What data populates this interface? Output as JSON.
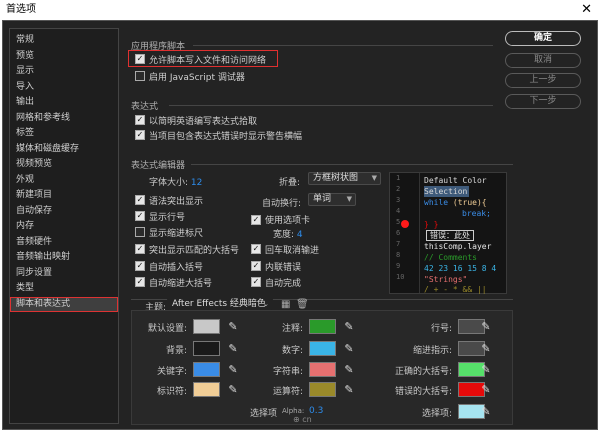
{
  "window": {
    "title": "首选项"
  },
  "sidebar": {
    "items": [
      "常规",
      "预览",
      "显示",
      "导入",
      "输出",
      "网格和参考线",
      "标签",
      "媒体和磁盘缓存",
      "视频预览",
      "外观",
      "新建项目",
      "自动保存",
      "内存",
      "音频硬件",
      "音频输出映射",
      "同步设置",
      "类型",
      "脚本和表达式"
    ],
    "active_index": 17
  },
  "buttons": {
    "ok": "确定",
    "cancel": "取消",
    "prev": "上一步",
    "next": "下一步"
  },
  "app_scripts": {
    "title": "应用程序脚本",
    "allow_write": {
      "label": "允许脚本写入文件和访问网络",
      "checked": true
    },
    "js_debugger": {
      "label": "启用 JavaScript 调试器",
      "checked": false
    }
  },
  "expressions": {
    "title": "表达式",
    "pick_english": {
      "label": "以简明英语编写表达式拾取",
      "checked": true
    },
    "warn_banner": {
      "label": "当项目包含表达式错误时显示警告横幅",
      "checked": true
    }
  },
  "editor": {
    "title": "表达式编辑器",
    "font_size_label": "字体大小:",
    "font_size": "12",
    "fold_label": "折叠:",
    "fold_value": "方框树状图",
    "autowrap_label": "自动换行:",
    "autowrap_value": "单词",
    "syntax_highlight": {
      "label": "语法突出显示",
      "checked": true
    },
    "line_numbers": {
      "label": "显示行号",
      "checked": true
    },
    "indent_guides": {
      "label": "显示缩进标尺",
      "checked": false
    },
    "match_brackets": {
      "label": "突出显示匹配的大括号",
      "checked": true
    },
    "auto_brackets": {
      "label": "自动插入括号",
      "checked": true
    },
    "auto_indent": {
      "label": "自动缩进大括号",
      "checked": true
    },
    "tabs": {
      "label": "使用选项卡",
      "checked": true
    },
    "width_label": "宽度:",
    "width_value": "4",
    "enter_accept": {
      "label": "回车取消输进",
      "checked": true
    },
    "inline_errors": {
      "label": "内联错误",
      "checked": true
    },
    "autocomplete": {
      "label": "自动完成",
      "checked": true
    }
  },
  "code_preview": {
    "line_numbers": [
      "1",
      "2",
      "3",
      "4",
      "5",
      "6",
      "7",
      "8",
      "9",
      "10"
    ],
    "line1": "Default Color",
    "line2": "Selection",
    "line3a": "while",
    "line3b": " (true){",
    "line4": "break;",
    "line5": "} }",
    "error_label": "错误：此处",
    "line6": "thisComp.layer",
    "line7": "// Comments",
    "line8": "42 23 16 15 8 4",
    "line9": "\"Strings\"",
    "line10": "/ + - * && ||"
  },
  "theme": {
    "label": "主题:",
    "value": "After Effects 经典暗色",
    "rows": [
      [
        {
          "label": "默认设置:",
          "color": "#c8c8c8"
        },
        {
          "label": "注释:",
          "color": "#2a9a2a"
        },
        {
          "label": "行号:",
          "color": "#4a4a4a"
        }
      ],
      [
        {
          "label": "背景:",
          "color": "#1a1a1a"
        },
        {
          "label": "数字:",
          "color": "#3ab4e6"
        },
        {
          "label": "缩进指示:",
          "color": "#4a4a4a"
        }
      ],
      [
        {
          "label": "关键字:",
          "color": "#3a8ce6"
        },
        {
          "label": "字符串:",
          "color": "#e67070"
        },
        {
          "label": "正确的大括号:",
          "color": "#56e06a"
        }
      ],
      [
        {
          "label": "标识符:",
          "color": "#f0cd96"
        },
        {
          "label": "运算符:",
          "color": "#9a8a2a"
        },
        {
          "label": "错误的大括号:",
          "color": "#e60a0a"
        }
      ]
    ],
    "last_left_label": "选择项",
    "alpha_label": "Alpha:",
    "alpha_value": "0.3",
    "last_right_label": "选择项:",
    "last_right_color": "#a6e4f0"
  }
}
